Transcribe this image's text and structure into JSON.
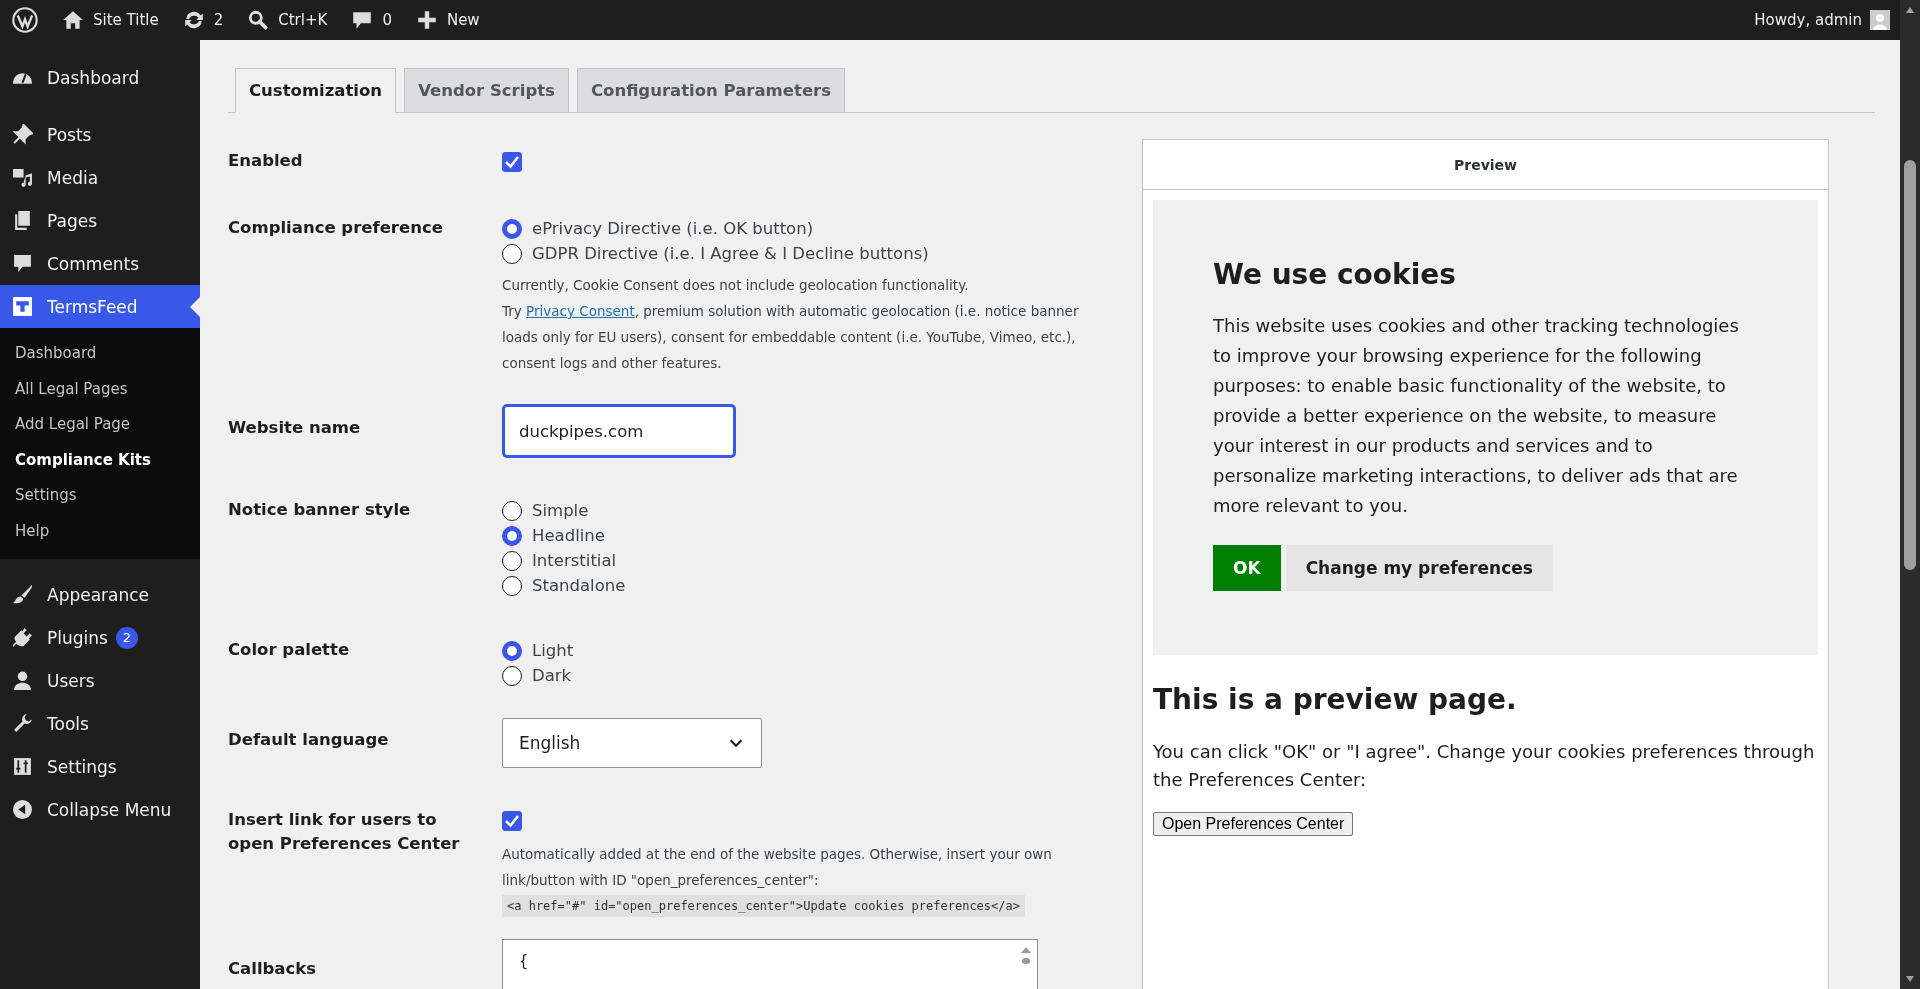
{
  "admin_bar": {
    "items": [
      {
        "kind": "logo"
      },
      {
        "kind": "home",
        "label": "Site Title"
      },
      {
        "kind": "updates",
        "label": "2"
      },
      {
        "kind": "search",
        "label": "Ctrl+K"
      },
      {
        "kind": "comments",
        "label": "0"
      },
      {
        "kind": "new",
        "label": "New"
      }
    ],
    "account": "Howdy, admin"
  },
  "sidebar": {
    "items": [
      {
        "kind": "dashboard",
        "label": "Dashboard",
        "selected": false
      },
      {
        "kind": "posts",
        "label": "Posts",
        "selected": false
      },
      {
        "kind": "media",
        "label": "Media",
        "selected": false
      },
      {
        "kind": "pages",
        "label": "Pages",
        "selected": false
      },
      {
        "kind": "comments",
        "label": "Comments",
        "selected": false
      },
      {
        "kind": "termsfeed",
        "label": "TermsFeed",
        "selected": true,
        "children": [
          {
            "label": "Dashboard",
            "selected": false
          },
          {
            "label": "All Legal Pages",
            "selected": false
          },
          {
            "label": "Add Legal Page",
            "selected": false
          },
          {
            "label": "Compliance Kits",
            "selected": true
          },
          {
            "label": "Settings",
            "selected": false
          },
          {
            "label": "Help",
            "selected": false
          }
        ]
      },
      {
        "kind": "appearance",
        "label": "Appearance",
        "selected": false
      },
      {
        "kind": "plugins",
        "label": "Plugins",
        "selected": false,
        "badge": "2"
      },
      {
        "kind": "users",
        "label": "Users",
        "selected": false
      },
      {
        "kind": "tools",
        "label": "Tools",
        "selected": false
      },
      {
        "kind": "settings",
        "label": "Settings",
        "selected": false
      },
      {
        "kind": "collapse",
        "label": "Collapse Menu",
        "selected": false
      }
    ]
  },
  "tabs": [
    {
      "label": "Customization",
      "selected": true
    },
    {
      "label": "Vendor Scripts",
      "selected": false
    },
    {
      "label": "Configuration Parameters",
      "selected": false
    }
  ],
  "form": [
    {
      "kind": "checkbox",
      "label": "Enabled",
      "checked": true
    },
    {
      "kind": "radio",
      "label": "Compliance preference",
      "options": [
        {
          "label": "ePrivacy Directive (i.e. OK button)",
          "selected": true
        },
        {
          "label": "GDPR Directive (i.e. I Agree & I Decline buttons)",
          "selected": false
        }
      ],
      "help": [
        "Currently, Cookie Consent does not include geolocation functionality."
      ],
      "promo": {
        "before": "Try",
        "link": "Privacy Consent",
        "after": ", premium solution with automatic geolocation (i.e. notice banner loads only for EU users), consent for embeddable content (i.e. YouTube, Vimeo, etc.), consent logs and other features."
      }
    },
    {
      "kind": "text",
      "label": "Website name",
      "value": "duckpipes.com"
    },
    {
      "kind": "radio",
      "label": "Notice banner style",
      "options": [
        {
          "label": "Simple",
          "selected": false
        },
        {
          "label": "Headline",
          "selected": true
        },
        {
          "label": "Interstitial",
          "selected": false
        },
        {
          "label": "Standalone",
          "selected": false
        }
      ]
    },
    {
      "kind": "radio",
      "label": "Color palette",
      "options": [
        {
          "label": "Light",
          "selected": true
        },
        {
          "label": "Dark",
          "selected": false
        }
      ]
    },
    {
      "kind": "select",
      "label": "Default language",
      "value": "English"
    },
    {
      "kind": "checkbox",
      "label": "Insert link for users to open Preferences Center",
      "checked": true,
      "help": [
        "Automatically added at the end of the website pages. Otherwise, insert your own link/button with ID \"open_preferences_center\":"
      ],
      "code": "<a href=\"#\" id=\"open_preferences_center\">Update cookies preferences</a>"
    },
    {
      "kind": "textarea",
      "label": "Callbacks",
      "value": "{"
    }
  ],
  "preview": {
    "title": "Preview",
    "banner": {
      "heading": "We use cookies",
      "body": "This website uses cookies and other tracking technologies to improve your browsing experience for the following purposes: to enable basic functionality of the website, to provide a better experience on the website, to measure your interest in our products and services and to personalize marketing interactions, to deliver ads that are more relevant to you.",
      "ok": "OK",
      "change": "Change my preferences"
    },
    "page_heading": "This is a preview page.",
    "page_text": "You can click \"OK\" or \"I agree\". Change your cookies preferences through the Preferences Center:",
    "page_button": "Open Preferences Center"
  }
}
